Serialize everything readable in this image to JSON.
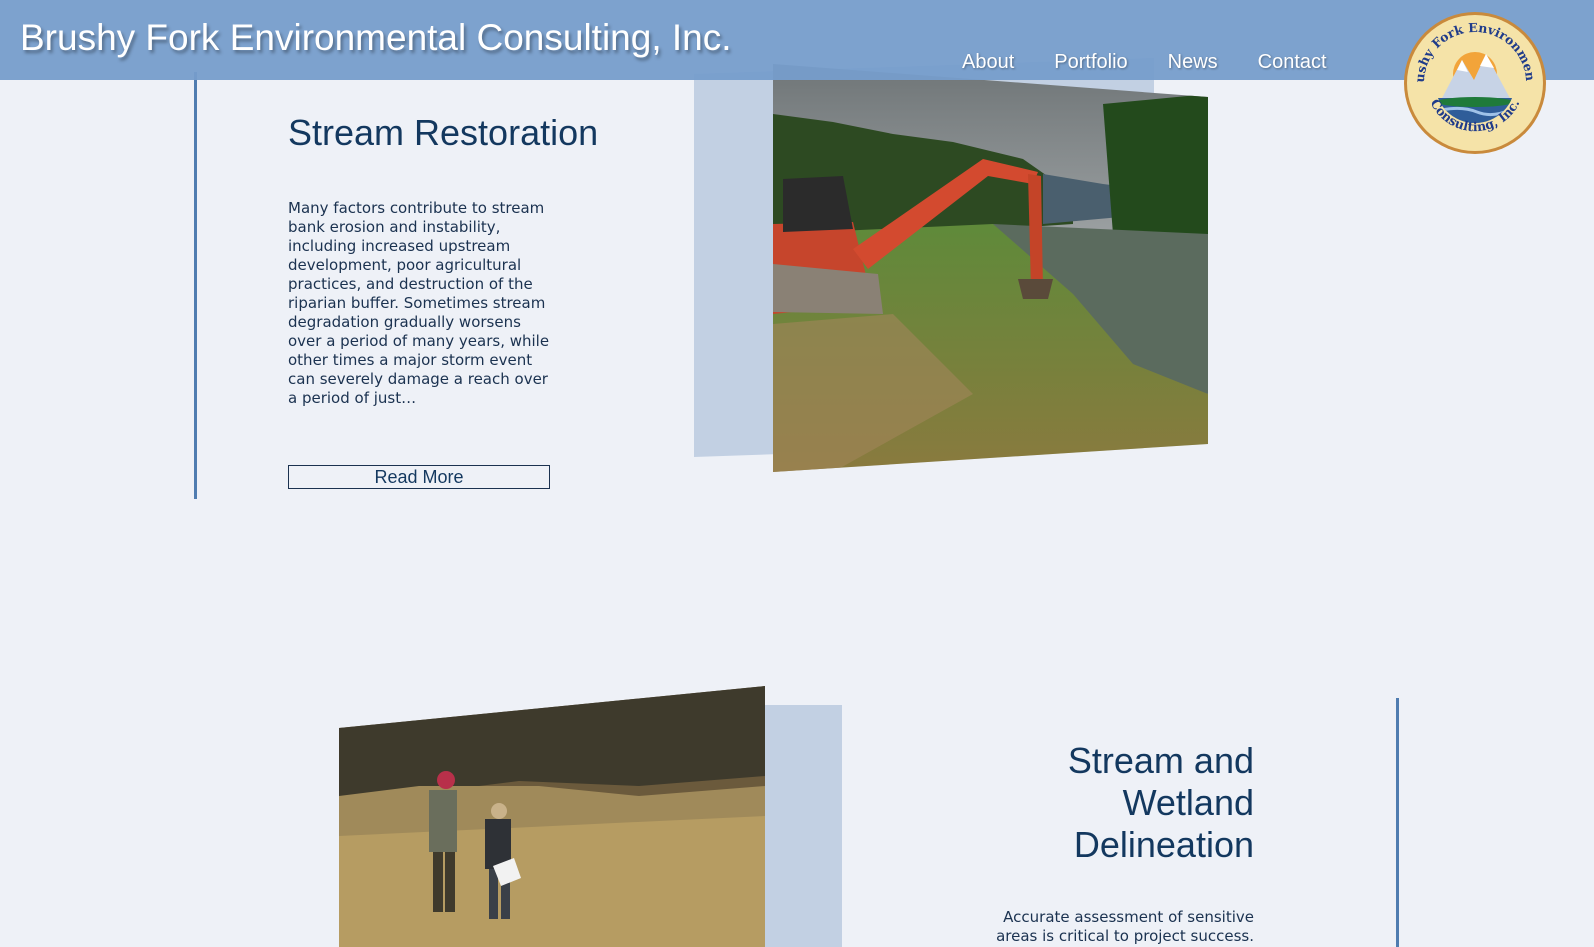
{
  "header": {
    "site_title": "Brushy Fork Environmental Consulting, Inc.",
    "nav": [
      "About",
      "Portfolio",
      "News",
      "Contact"
    ],
    "logo_text_top": "Brushy Fork Environmental",
    "logo_text_bottom": "Consulting, Inc."
  },
  "sections": [
    {
      "title": "Stream Restoration",
      "text": "Many factors contribute to stream bank erosion and instability, including increased upstream development, poor agricultural practices, and destruction of the riparian buffer. Sometimes stream degradation gradually worsens over a period of many years, while other times a major storm event can severely damage a reach over a period of just…",
      "button": "Read More",
      "image": "excavator-on-riverbank-photo"
    },
    {
      "title": "Stream and Wetland Delineation",
      "text": "Accurate assessment of sensitive areas is critical to project success.",
      "image": "field-survey-people-photo"
    }
  ],
  "colors": {
    "header_bg": "#769dcb",
    "heading": "#13385f",
    "accent_line": "#4f7cb0",
    "page_bg": "#eef1f7"
  }
}
